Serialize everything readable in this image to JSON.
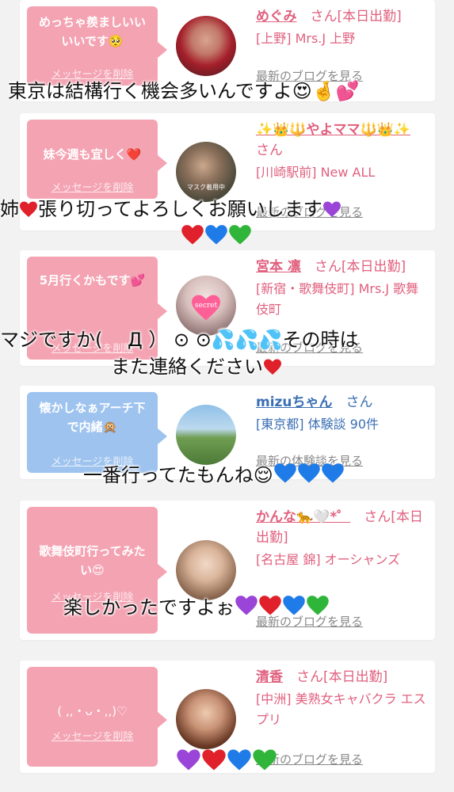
{
  "cards": [
    {
      "bubble_text": "めっちゃ羨ましいいいいです🥺",
      "bubble_delete": "メッセージを削除",
      "name": "めぐみ",
      "suffix": "さん[本日出勤]",
      "location": "[上野] Mrs.J 上野",
      "link": "最新のブログを見る"
    },
    {
      "bubble_text": "妹今週も宜しく❤️",
      "bubble_delete": "メッセージを削除",
      "name": "✨👑🔱やよママ🔱👑✨",
      "suffix": "さん",
      "location": "[川崎駅前] New ALL",
      "link": "最新のブログを見る",
      "avatar_caption": "マスク着用中"
    },
    {
      "bubble_text": "5月行くかもです💕",
      "bubble_delete": "メッセージを削除",
      "name": "宮本 凛",
      "suffix": "さん[本日出勤]",
      "location": "[新宿・歌舞伎町] Mrs.J 歌舞伎町",
      "link": "最新のブログを見る",
      "avatar_caption": "secret"
    },
    {
      "bubble_text": "懐かしなぁアーチ下で内緒🙊",
      "bubble_delete": "メッセージを削除",
      "name": "mizuちゃん",
      "suffix": "さん",
      "location": "[東京都] 体験談 90件",
      "link": "最新の体験談を見る"
    },
    {
      "bubble_text": "歌舞伎町行ってみたい😍",
      "bubble_delete": "メッセージを削除",
      "name": "かんな🐆🤍*゜",
      "suffix": "さん[本日出勤]",
      "location": "[名古屋 錦] オーシャンズ",
      "link": "最新のブログを見る"
    },
    {
      "bubble_text": "( ,,・ᴗ・,,)♡",
      "bubble_delete": "メッセージを削除",
      "name": "清香",
      "suffix": "さん[本日出勤]",
      "location": "[中洲] 美熟女キャバクラ エスプリ",
      "link": "最新のブログを見る"
    }
  ],
  "overlays": {
    "line1": "東京は結構行く機会多いんですよ😍🤞💕",
    "line2a": "姉",
    "line2b": "張り切ってよろしくお願いします",
    "line3a": "マジですか(　 Д ）  ⊙ ⊙💦💦💦その時は",
    "line3b": "また連絡ください",
    "line4": "一番行ってたもんね😌",
    "line5": "楽しかったですよぉ"
  },
  "colors": {
    "pink_bubble": "#f4a3b2",
    "blue_bubble": "#9ec3ef",
    "name_pink": "#e0607e",
    "name_blue": "#3a6fb3",
    "heart_red": "#e0202a",
    "heart_blue": "#1f7be8",
    "heart_green": "#2fb53a",
    "heart_purple": "#9b45d8"
  }
}
